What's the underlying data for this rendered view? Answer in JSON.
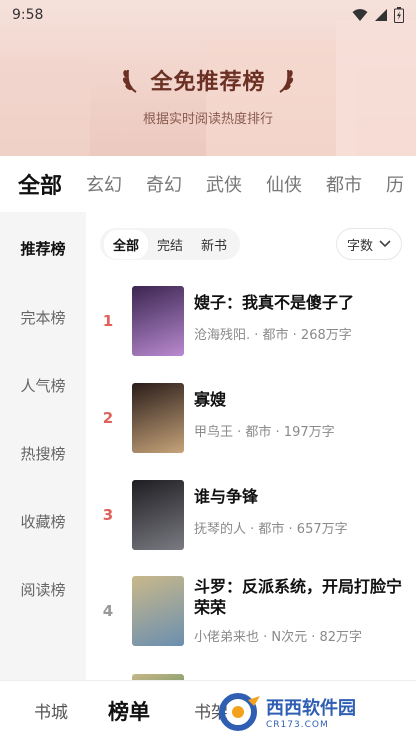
{
  "status_bar": {
    "time": "9:58"
  },
  "header": {
    "title": "全免推荐榜",
    "subtitle": "根据实时阅读热度排行"
  },
  "category_tabs": [
    {
      "label": "全部",
      "active": true
    },
    {
      "label": "玄幻",
      "active": false
    },
    {
      "label": "奇幻",
      "active": false
    },
    {
      "label": "武侠",
      "active": false
    },
    {
      "label": "仙侠",
      "active": false
    },
    {
      "label": "都市",
      "active": false
    },
    {
      "label": "历",
      "active": false
    }
  ],
  "sidebar": {
    "items": [
      {
        "label": "推荐榜",
        "active": true
      },
      {
        "label": "完本榜",
        "active": false
      },
      {
        "label": "人气榜",
        "active": false
      },
      {
        "label": "热搜榜",
        "active": false
      },
      {
        "label": "收藏榜",
        "active": false
      },
      {
        "label": "阅读榜",
        "active": false
      }
    ]
  },
  "filters": {
    "options": [
      {
        "label": "全部",
        "active": true
      },
      {
        "label": "完结",
        "active": false
      },
      {
        "label": "新书",
        "active": false
      }
    ],
    "sort_label": "字数"
  },
  "books": [
    {
      "rank": "1",
      "title": "嫂子：我真不是傻子了",
      "meta": "沧海残阳. · 都市 · 268万字",
      "cover_colors": [
        "#3a2550",
        "#b98ad0"
      ]
    },
    {
      "rank": "2",
      "title": "寡嫂",
      "meta": "甲鸟王 · 都市 · 197万字",
      "cover_colors": [
        "#2a1d1a",
        "#c7a47a"
      ]
    },
    {
      "rank": "3",
      "title": "谁与争锋",
      "meta": "抚琴的人 · 都市 · 657万字",
      "cover_colors": [
        "#1e1e22",
        "#7a7a82"
      ]
    },
    {
      "rank": "4",
      "title": "斗罗：反派系统，开局打脸宁荣荣",
      "meta": "小佬弟来也 · N次元 · 82万字",
      "cover_colors": [
        "#c9b88a",
        "#6b8fb0"
      ]
    }
  ],
  "bottom_nav": [
    {
      "label": "书城",
      "active": false
    },
    {
      "label": "榜单",
      "active": true
    },
    {
      "label": "书架",
      "active": false
    }
  ],
  "watermark": {
    "text": "西西软件园",
    "sub": "CR173.COM"
  }
}
